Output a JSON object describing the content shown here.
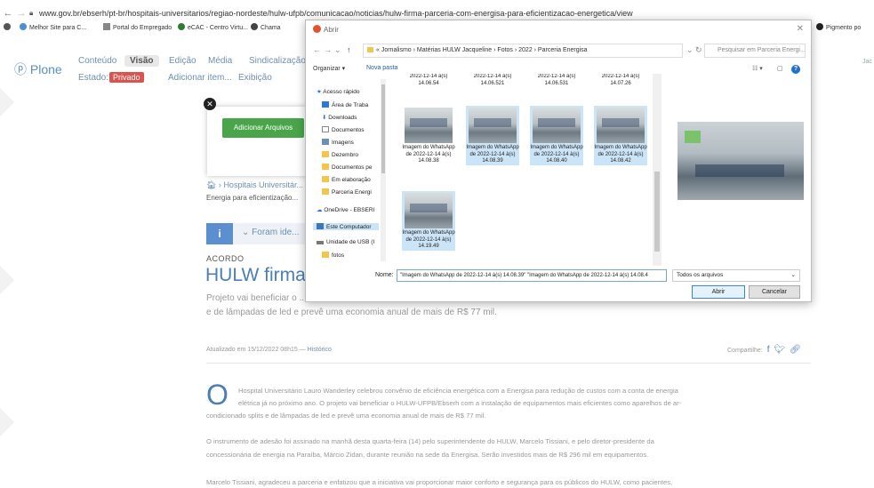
{
  "browser": {
    "url": "www.gov.br/ebserh/pt-br/hospitais-universitarios/regiao-nordeste/hulw-ufpb/comunicacao/noticias/hulw-firma-parceria-com-energisa-para-eficientizacao-energetica/view",
    "bookmarks": [
      "Melhor Site para C...",
      "Portal do Empregado",
      "eCAC - Centro Virtu...",
      "Chama"
    ],
    "bookmark_right": "Pigmento po"
  },
  "plone": {
    "logo": "Plone",
    "tabs": [
      "Conteúdo",
      "Visão",
      "Edição",
      "Média",
      "Sindicalização"
    ],
    "state_label": "Estado:",
    "state_value": "Privado",
    "add_item": "Adicionar item...",
    "display": "Exibição",
    "user_right": "Jac"
  },
  "page": {
    "upload_button": "Adicionar Arquivos",
    "breadcrumb": "Hospitais Universitár...",
    "summary_short": "Energia para eficientização...",
    "info_text": "Foram ide...",
    "kicker": "ACORDO",
    "title": "HULW firma...",
    "lead1": "Projeto vai beneficiar o ...",
    "lead2": "e de lâmpadas de led e prevê uma economia anual de mais de R$ 77 mil.",
    "updated": "Atualizado em 15/12/2022 08h15 — ",
    "history_link": "Histórico",
    "share_label": "Compartilhe:",
    "dropcap": "O",
    "paragraphs": [
      "Hospital Universitário Lauro Wanderley celebrou convênio de eficiência energética com a Energisa para redução de custos com a conta de energia",
      "elétrica já no próximo ano. O projeto vai beneficiar o HULW-UFPB/Ebserh com a instalação de equipamentos mais eficientes como aparelhos de ar-",
      "condicionado splits e de lâmpadas de led e prevê uma economia anual de mais de R$ 77 mil.",
      "O instrumento de adesão foi assinado na manhã desta quarta-feira (14) pelo superintendente do HULW, Marcelo Tissiani, e pelo diretor-presidente da",
      "concessionária de energia na Paraíba, Márcio Zidan, durante reunião na sede da Energisa. Serão investidos mais de R$ 296 mil em equipamentos.",
      "Marcelo Tissiani, agradeceu a parceria e enfatizou que a iniciativa vai proporcionar maior conforto e segurança para os públicos do HULW, como pacientes,"
    ]
  },
  "dialog": {
    "title": "Abrir",
    "path": "« Jornalismo  ›  Matérias HULW Jacqueline  ›  Fotos  ›  2022  ›  Parceria Energisa",
    "search_placeholder": "Pesquisar em Parceria Energi...",
    "organize": "Organizar ▾",
    "new_folder": "Nova pasta",
    "nav_items": [
      "Acesso rápido",
      "Área de Traba",
      "Downloads",
      "Documentos",
      "Imagens",
      "Dezembro",
      "Documentos pe",
      "Em elaboração",
      "Parceria Energi",
      "OneDrive - EBSERI",
      "Este Computador",
      "Unidade de USB (I",
      "fotos"
    ],
    "top_files": [
      "2022-12-14 à(s) 14.06.54",
      "2022-12-14 à(s) 14.06.521",
      "2022-12-14 à(s) 14.06.531",
      "2022-12-14 à(s) 14.07.26"
    ],
    "files": [
      {
        "name": "Imagem do WhatsApp de 2022-12-14 à(s) 14.08.38"
      },
      {
        "name": "Imagem do WhatsApp de 2022-12-14 à(s) 14.08.39"
      },
      {
        "name": "Imagem do WhatsApp de 2022-12-14 à(s) 14.08.40"
      },
      {
        "name": "Imagem do WhatsApp de 2022-12-14 à(s) 14.08.42"
      },
      {
        "name": "Imagem do WhatsApp de 2022-12-14 à(s) 14.19.49"
      }
    ],
    "name_label": "Nome:",
    "name_value": "\"Imagem do WhatsApp de 2022-12-14 à(s) 14.08.39\" \"Imagem do WhatsApp de 2022-12-14 à(s) 14.08.4",
    "file_type": "Todos os arquivos",
    "open": "Abrir",
    "cancel": "Cancelar"
  }
}
